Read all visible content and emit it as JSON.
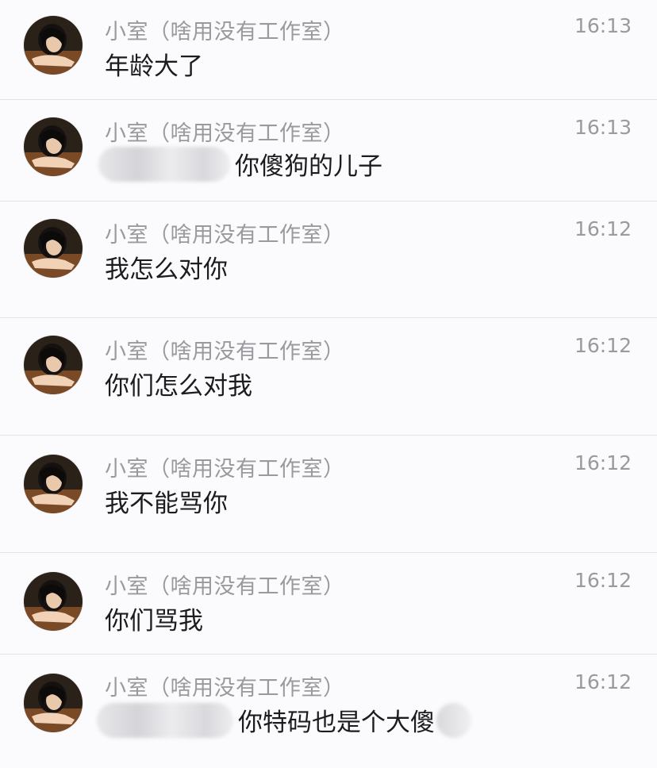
{
  "conversation": {
    "messages": [
      {
        "sender": "小室（啥用没有工作室）",
        "time": "16:13",
        "text": "年龄大了",
        "redacted_prefix": false,
        "redacted_suffix": false
      },
      {
        "sender": "小室（啥用没有工作室）",
        "time": "16:13",
        "text": "你傻狗的儿子",
        "redacted_prefix": true,
        "redacted_suffix": false
      },
      {
        "sender": "小室（啥用没有工作室）",
        "time": "16:12",
        "text": "我怎么对你",
        "redacted_prefix": false,
        "redacted_suffix": false
      },
      {
        "sender": "小室（啥用没有工作室）",
        "time": "16:12",
        "text": "你们怎么对我",
        "redacted_prefix": false,
        "redacted_suffix": false
      },
      {
        "sender": "小室（啥用没有工作室）",
        "time": "16:12",
        "text": "我不能骂你",
        "redacted_prefix": false,
        "redacted_suffix": false
      },
      {
        "sender": "小室（啥用没有工作室）",
        "time": "16:12",
        "text": "你们骂我",
        "redacted_prefix": false,
        "redacted_suffix": false
      },
      {
        "sender": "小室（啥用没有工作室）",
        "time": "16:12",
        "text": "你特码也是个大傻",
        "redacted_prefix": true,
        "redacted_suffix": true
      }
    ]
  },
  "icons": {
    "avatar": "user-avatar-photo"
  },
  "colors": {
    "background": "#f6f6f9",
    "row_background": "#fbfbfd",
    "divider": "#e3e3e6",
    "sender_text": "#9a9a9e",
    "message_text": "#1c1c1e"
  }
}
